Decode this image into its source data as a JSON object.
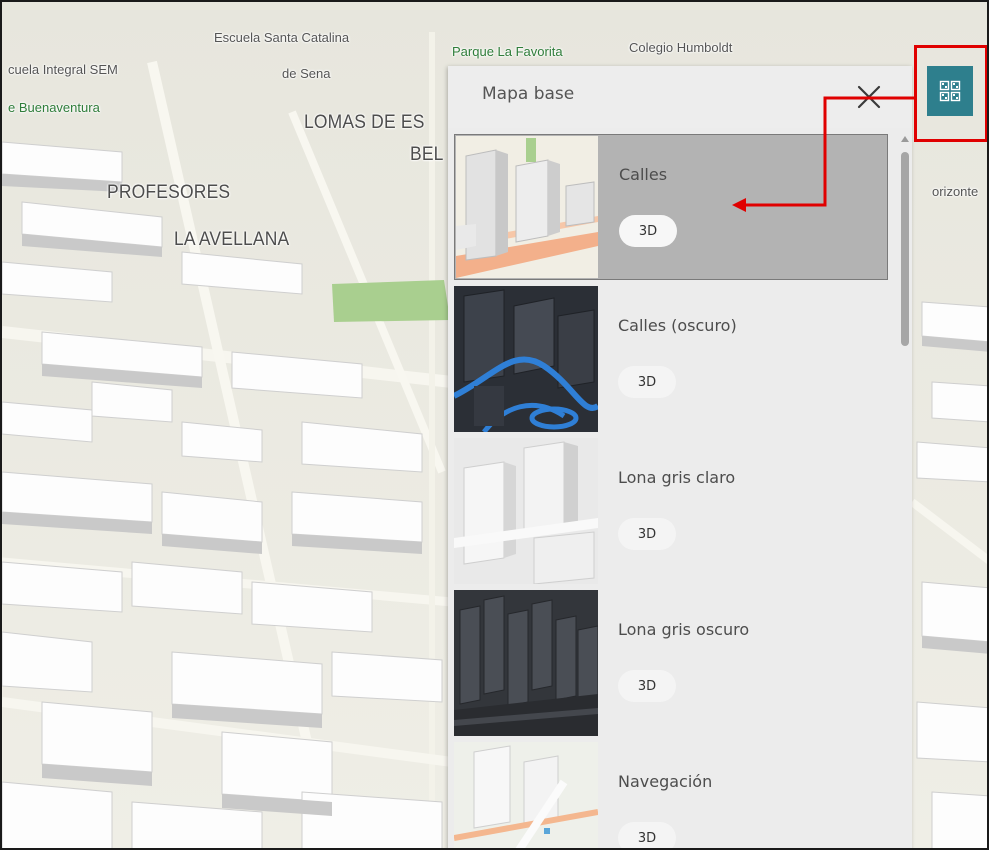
{
  "map": {
    "labels": {
      "escuela_santa_catalina": "Escuela Santa Catalina",
      "escuela_integral_sem": "cuela Integral SEM",
      "de_sena": "de Sena",
      "parque_la_favorita": "Parque La Favorita",
      "colegio_humboldt": "Colegio Humboldt",
      "buenaventura": "e Buenaventura",
      "lomas_de_es": "LOMAS DE ES",
      "bel": "BEL",
      "profesores": "PROFESORES",
      "la_avellana": "LA AVELLANA",
      "horizonte": "orizonte"
    }
  },
  "basemap_widget": {
    "button_icon": "basemap-gallery-icon",
    "accent_color": "#2e7f8d",
    "highlight_color": "#e00000"
  },
  "panel": {
    "title": "Mapa base",
    "close_icon": "close-icon",
    "items": [
      {
        "label": "Calles",
        "badge": "3D",
        "selected": true,
        "thumb": "streets"
      },
      {
        "label": "Calles (oscuro)",
        "badge": "3D",
        "selected": false,
        "thumb": "streets-dark"
      },
      {
        "label": "Lona gris claro",
        "badge": "3D",
        "selected": false,
        "thumb": "light-gray"
      },
      {
        "label": "Lona gris oscuro",
        "badge": "3D",
        "selected": false,
        "thumb": "dark-gray"
      },
      {
        "label": "Navegación",
        "badge": "3D",
        "selected": false,
        "thumb": "navigation"
      }
    ]
  }
}
